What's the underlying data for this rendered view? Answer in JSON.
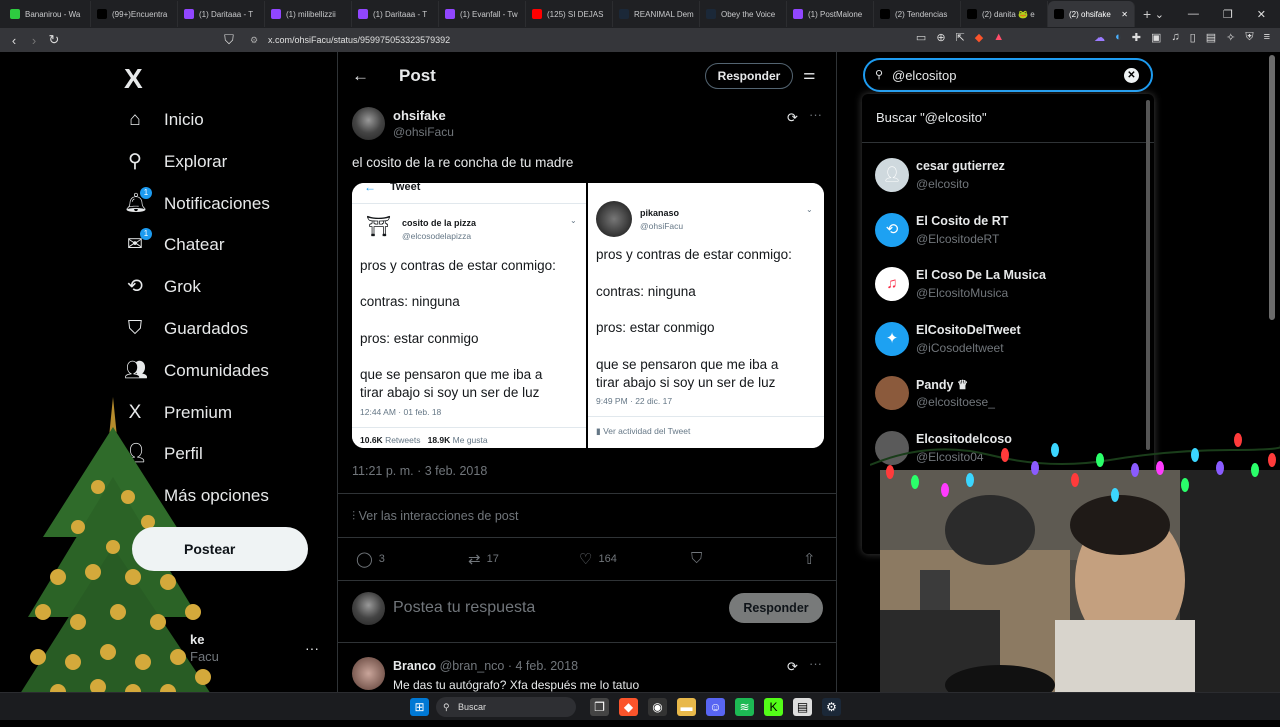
{
  "browser": {
    "tabs": [
      {
        "label": "Bananirou - Wa",
        "color": "#2ecc40"
      },
      {
        "label": "(99+)Encuentra",
        "color": "#000000"
      },
      {
        "label": "(1) Daritaaa - T",
        "color": "#9146ff"
      },
      {
        "label": "(1) milibellizzii",
        "color": "#9146ff"
      },
      {
        "label": "(1) Daritaaa - T",
        "color": "#9146ff"
      },
      {
        "label": "(1) Evanfall - Tw",
        "color": "#9146ff"
      },
      {
        "label": "(125) SI DEJAS",
        "color": "#ff0000"
      },
      {
        "label": "REANIMAL Dem",
        "color": "#1b2838"
      },
      {
        "label": "Obey the Voice",
        "color": "#1b2838"
      },
      {
        "label": "(1) PostMalone",
        "color": "#9146ff"
      },
      {
        "label": "(2) Tendencias",
        "color": "#000000"
      },
      {
        "label": "(2) danita 🐸 e",
        "color": "#000000"
      },
      {
        "label": "(2) ohsifake",
        "color": "#000000"
      }
    ],
    "new_tab": "+",
    "url": "x.com/ohsiFacu/status/959975053323579392"
  },
  "nav": {
    "logo": "X",
    "items": [
      {
        "label": "Inicio",
        "icon": "⌂"
      },
      {
        "label": "Explorar",
        "icon": "⚲"
      },
      {
        "label": "Notificaciones",
        "icon": "🔔︎",
        "badge": "1"
      },
      {
        "label": "Chatear",
        "icon": "✉",
        "badge": "1"
      },
      {
        "label": "Grok",
        "icon": "⟲"
      },
      {
        "label": "Guardados",
        "icon": "⛉"
      },
      {
        "label": "Comunidades",
        "icon": "👥︎"
      },
      {
        "label": "Premium",
        "icon": "X"
      },
      {
        "label": "Perfil",
        "icon": "👤︎"
      },
      {
        "label": "Más opciones",
        "icon": "⋯"
      }
    ],
    "post_button": "Postear",
    "account_name": "ke",
    "account_handle": "Facu",
    "account_more": "···"
  },
  "header": {
    "title": "Post",
    "reply_button": "Responder"
  },
  "tweet": {
    "name": "ohsifake",
    "handle": "@ohsiFacu",
    "text": "el cosito de la re concha de tu madre",
    "timestamp": "11:21 p. m. · 3 feb. 2018",
    "interactions_link": "Ver las interacciones de post",
    "stats": {
      "replies": "3",
      "retweets": "17",
      "likes": "164"
    },
    "reply_placeholder": "Postea tu respuesta",
    "reply_button": "Responder"
  },
  "media": {
    "left": {
      "title": "Tweet",
      "name": "cosito de la pizza",
      "handle": "@elcosodelapizza",
      "lines": [
        "pros y contras de estar conmigo:",
        "contras: ninguna",
        "pros: estar conmigo",
        "que se pensaron que me iba a tirar abajo si soy un ser de luz"
      ],
      "time": "12:44 AM · 01 feb. 18",
      "retweets": "10.6K",
      "retweets_label": "Retweets",
      "likes": "18.9K",
      "likes_label": "Me gusta"
    },
    "right": {
      "name": "pikanaso",
      "handle": "@ohsiFacu",
      "lines": [
        "pros y contras de estar conmigo:",
        "contras: ninguna",
        "pros: estar conmigo",
        "que se pensaron que me iba a tirar abajo si soy un ser de luz"
      ],
      "time": "9:49 PM · 22 dic. 17",
      "activity": "Ver actividad del Tweet"
    }
  },
  "reply": {
    "name": "Branco",
    "handle": "@bran_nco · 4 feb. 2018",
    "text": "Me das tu autógrafo? Xfa después me lo tatuo"
  },
  "search": {
    "value": "@elcositop",
    "query_label": "Buscar \"@elcosito\"",
    "suggestions": [
      {
        "name": "cesar gutierrez",
        "handle": "@elcosito",
        "color": "#cfd9de",
        "glyph": "👤︎"
      },
      {
        "name": "El Cosito de RT",
        "handle": "@ElcositodeRT",
        "color": "#1da1f2",
        "glyph": "⟲"
      },
      {
        "name": "El Coso De La Musica",
        "handle": "@ElcositoMusica",
        "color": "#ffffff",
        "glyph": "♫"
      },
      {
        "name": "ElCositoDelTweet",
        "handle": "@iCosodeltweet",
        "color": "#1da1f2",
        "glyph": "✦"
      },
      {
        "name": "Pandy ♛",
        "handle": "@elcositoese_",
        "color": "#8b5a3c",
        "glyph": ""
      },
      {
        "name": "Elcositodelcoso",
        "handle": "@Elcosito04",
        "color": "#5a5a5a",
        "glyph": ""
      }
    ]
  },
  "taskbar": {
    "search_label": "Buscar"
  }
}
